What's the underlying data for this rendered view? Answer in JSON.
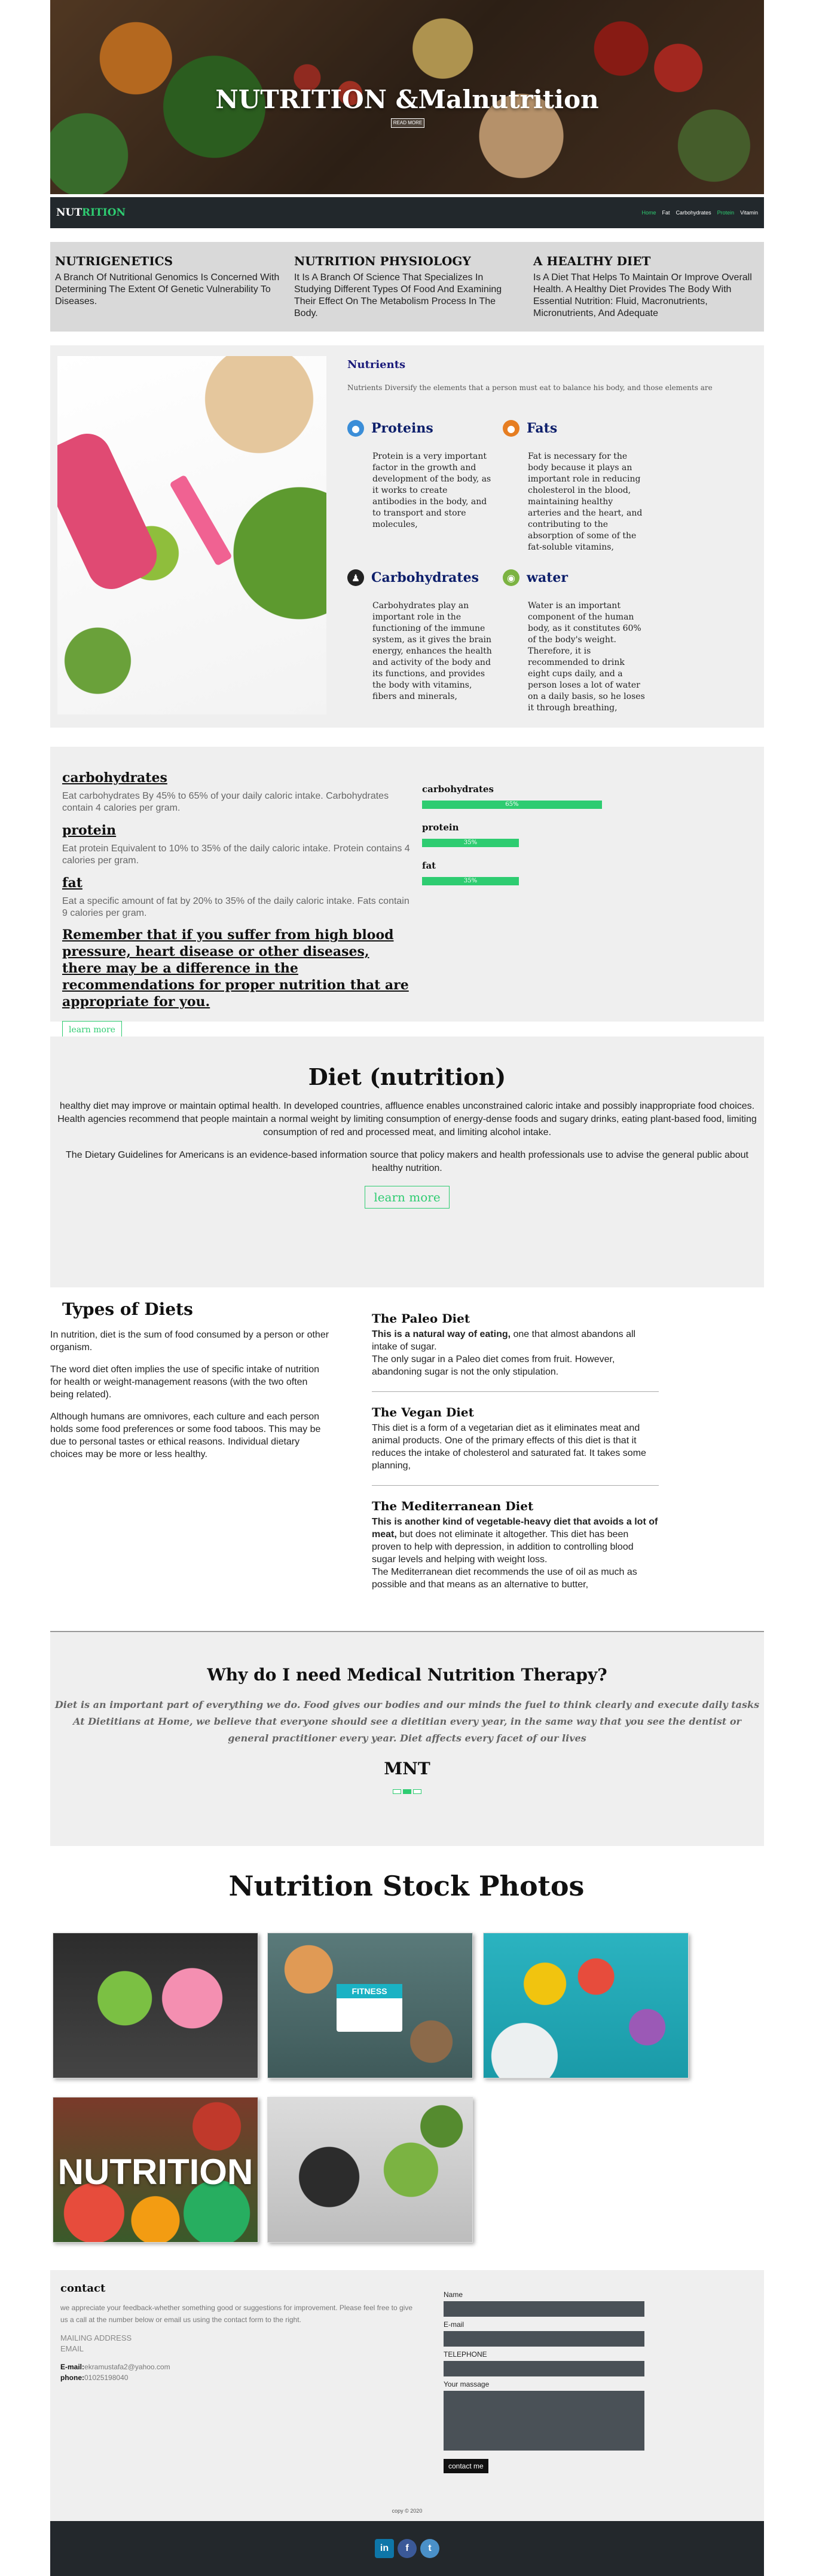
{
  "hero": {
    "title": "NUTRITION &Malnutrition",
    "button_label": "READ MORE"
  },
  "nav": {
    "logo_first": "NUT",
    "logo_rest": "RITION",
    "links": [
      "Home",
      "Fat",
      "Carbohydrates",
      "Protein",
      "Vitamin"
    ]
  },
  "intro": [
    {
      "title": "NUTRIGENETICS",
      "text": "A Branch Of Nutritional Genomics Is Concerned With Determining The Extent Of Genetic Vulnerability To Diseases."
    },
    {
      "title": "NUTRITION PHYSIOLOGY",
      "text": "It Is A Branch Of Science That Specializes In Studying Different Types Of Food And Examining Their Effect On The Metabolism Process In The Body."
    },
    {
      "title": "A HEALTHY DIET",
      "text": "Is A Diet That Helps To Maintain Or Improve Overall Health. A Healthy Diet Provides The Body With Essential Nutrition: Fluid, Macronutrients, Micronutrients, And Adequate"
    }
  ],
  "nutrients": {
    "title": "Nutrients",
    "subtitle": "Nutrients Diversify the elements that a person must eat to balance his body, and those elements are",
    "items": [
      {
        "name": "Proteins",
        "icon": "egg-icon",
        "color": "#3b8ed8",
        "text": "Protein is a very important factor in the growth and development of the body, as it works to create antibodies in the body, and to transport and store molecules,"
      },
      {
        "name": "Fats",
        "icon": "drop-icon",
        "color": "#e67e22",
        "text": "Fat is necessary for the body because it plays an important role in reducing cholesterol in the blood, maintaining healthy arteries and the heart, and contributing to the absorption of some of the fat-soluble vitamins,"
      },
      {
        "name": "Carbohydrates",
        "icon": "person-icon",
        "color": "#222222",
        "text": "Carbohydrates play an important role in the functioning of the immune system, as it gives the brain energy, enhances the health and activity of the body and its functions, and provides the body with vitamins, fibers and minerals,"
      },
      {
        "name": "water",
        "icon": "water-icon",
        "color": "#7cb342",
        "text": "Water is an important component of the human body, as it constitutes 60% of the body's weight. Therefore, it is recommended to drink eight cups daily, and a person loses a lot of water on a daily basis, so he loses it through breathing,"
      }
    ]
  },
  "goals": {
    "items": [
      {
        "title": "carbohydrates",
        "text": "Eat carbohydrates By 45% to 65% of your daily caloric intake. Carbohydrates contain 4 calories per gram."
      },
      {
        "title": "protein",
        "text": "Eat protein Equivalent to 10% to 35% of the daily caloric intake. Protein contains 4 calories per gram."
      },
      {
        "title": "fat",
        "text": "Eat a specific amount of fat by 20% to 35% of the daily caloric intake. Fats contain 9 calories per gram."
      }
    ],
    "warning": "Remember that if you suffer from high blood pressure, heart disease or other diseases, there may be a difference in the recommendations for proper nutrition that are appropriate for you.",
    "button_label": "learn more",
    "bars": [
      {
        "label": "carbohydrates",
        "value": 65,
        "text": "65%"
      },
      {
        "label": "protein",
        "value": 35,
        "text": "35%"
      },
      {
        "label": "fat",
        "value": 35,
        "text": "35%"
      }
    ]
  },
  "diet": {
    "title": "Diet (nutrition)",
    "p1": "healthy diet may improve or maintain optimal health. In developed countries, affluence enables unconstrained caloric intake and possibly inappropriate food choices. Health agencies recommend that people maintain a normal weight by limiting consumption of energy-dense foods and sugary drinks, eating plant-based food, limiting consumption of red and processed meat, and limiting alcohol intake.",
    "p2": "The Dietary Guidelines for Americans is an evidence-based information source that policy makers and health professionals use to advise the general public about healthy nutrition.",
    "button_label": "learn more"
  },
  "types": {
    "title": "Types of Diets",
    "paragraphs": [
      "In nutrition, diet is the sum of food consumed by a person or other organism.",
      "The word diet often implies the use of specific intake of nutrition for health or weight-management reasons (with the two often being related).",
      "Although humans are omnivores, each culture and each person holds some food preferences or some food taboos. This may be due to personal tastes or ethical reasons. Individual dietary choices may be more or less healthy."
    ],
    "paleo": {
      "title": "The Paleo Diet",
      "bold": "This is a natural way of eating,",
      "rest": " one that almost abandons all intake of sugar.",
      "p2": "The only sugar in a Paleo diet comes from fruit. However, abandoning sugar is not the only stipulation."
    },
    "vegan": {
      "title": "The Vegan Diet",
      "text": "This diet is a form of a vegetarian diet as it eliminates meat and animal products. One of the primary effects of this diet is that it reduces the intake of cholesterol and saturated fat. It takes some planning,"
    },
    "med": {
      "title": "The Mediterranean Diet",
      "bold": "This is another kind of vegetable-heavy diet that avoids a lot of meat,",
      "rest": " but does not eliminate it altogether. This diet has been proven to help with depression, in addition to controlling blood sugar levels and helping with weight loss.",
      "p2": "The Mediterranean diet recommends the use of oil as much as possible and that means as an alternative to butter,"
    }
  },
  "mnt": {
    "title": "Why do I need Medical Nutrition Therapy?",
    "text": "Diet is an important part of everything we do. Food gives our bodies and our minds the fuel to think clearly and execute daily tasks At Dietitians at Home, we believe that everyone should see a dietitian every year, in the same way that you see the dentist or general practitioner every year. Diet affects every facet of our lives",
    "subtitle": "MNT"
  },
  "photos": {
    "title": "Nutrition Stock Photos",
    "fitness_label": "FITNESS",
    "nutrition_label": "NUTRITION"
  },
  "contact": {
    "title": "contact",
    "text": "we appreciate your feedback-whether something good or suggestions for improvement. Please feel free to give us a call at the number below or email us using the contact form to the right.",
    "mailing": "MAILING ADDRESS",
    "email_label": "EMAIL",
    "email_key": "E-mail:",
    "email_value": "ekramustafa2@yahoo.com",
    "phone_key": "phone:",
    "phone_value": "01025198040",
    "form": {
      "name": "Name",
      "email": "E-mail",
      "telephone": "TELEPHONE",
      "message": "Your massage",
      "submit": "contact me"
    },
    "copyright": "copy © 2020"
  },
  "footer": {
    "icons": [
      {
        "name": "linkedin-icon",
        "glyph": "in",
        "color": "#0e76a8"
      },
      {
        "name": "facebook-icon",
        "glyph": "f",
        "color": "#3b5998"
      },
      {
        "name": "twitter-icon",
        "glyph": "t",
        "color": "#4a90c8"
      }
    ]
  }
}
